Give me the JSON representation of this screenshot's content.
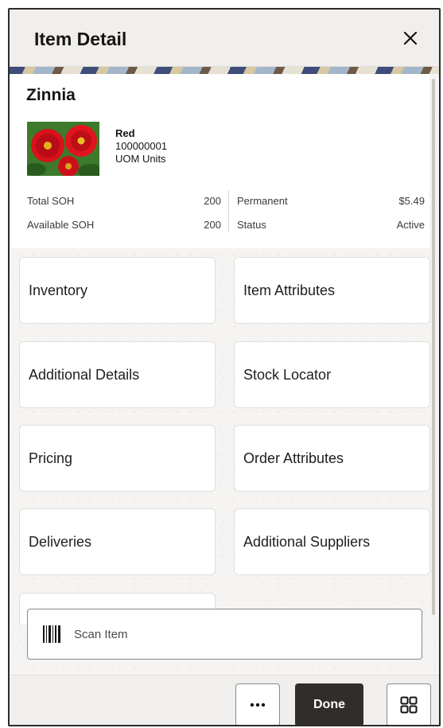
{
  "header": {
    "title": "Item Detail",
    "close_icon": "close-icon"
  },
  "item": {
    "name": "Zinnia",
    "color": "Red",
    "number": "100000001",
    "uom": "UOM Units",
    "image": "red-zinnia-flowers-photo"
  },
  "stats": [
    {
      "label": "Total SOH",
      "value": "200",
      "label2": "Permanent",
      "value2": "$5.49"
    },
    {
      "label": "Available SOH",
      "value": "200",
      "label2": "Status",
      "value2": "Active"
    }
  ],
  "tiles": [
    "Inventory",
    "Item Attributes",
    "Additional Details",
    "Stock Locator",
    "Pricing",
    "Order Attributes",
    "Deliveries",
    "Additional Suppliers"
  ],
  "scan": {
    "icon": "barcode-icon",
    "label": "Scan Item"
  },
  "footer": {
    "more_icon": "more-icon",
    "done_label": "Done",
    "grid_icon": "grid-icon"
  },
  "colors": {
    "primary_button": "#312d2a",
    "background": "#f5f4f2"
  }
}
